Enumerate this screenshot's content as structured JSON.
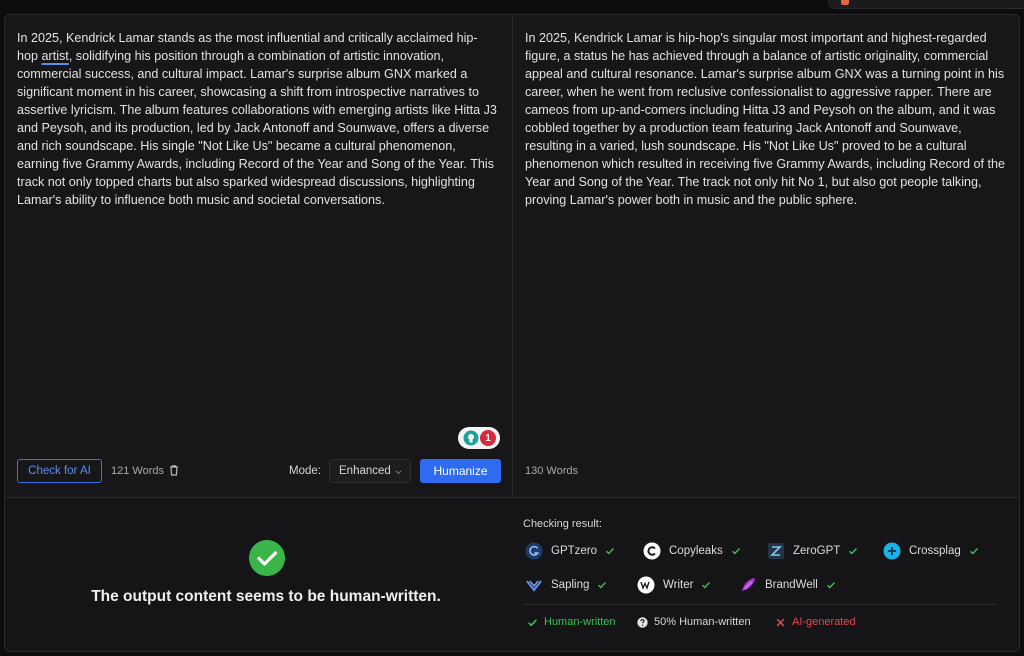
{
  "input": {
    "text_prefix": "In 2025, Kendrick Lamar stands as the most influential and critically acclaimed hip-hop ",
    "text_underlined": "artist",
    "text_suffix": ", solidifying his position through a combination of artistic innovation, commercial success, and cultural impact. Lamar's surprise album GNX marked a significant moment in his career, showcasing a shift from introspective narratives to assertive lyricism. The album features collaborations with emerging artists like Hitta J3 and Peysoh, and its production, led by Jack Antonoff and Sounwave, offers a diverse and rich soundscape. His single \"Not Like Us\" became a cultural phenomenon, earning five Grammy Awards, including Record of the Year and Song of the Year. This track not only topped charts but also sparked widespread discussions, highlighting Lamar's ability to influence both music and societal conversations.",
    "check_button": "Check for AI",
    "word_count": "121 Words",
    "mode_label": "Mode:",
    "mode_value": "Enhanced",
    "humanize_button": "Humanize",
    "suggestion_count": "1"
  },
  "output": {
    "text": "In 2025, Kendrick Lamar is hip-hop's singular most important and highest-regarded figure, a status he has  achieved through a balance of artistic originality, commercial appeal and cultural resonance. Lamar's surprise album GNX  was a turning point in his career, when he went from reclusive confessionalist to aggressive rapper. There are cameos from  up-and-comers including Hitta J3 and Peysoh on the album, and it was cobbled together by a production team featuring Jack Antonoff and Sounwave, resulting in a varied, lush soundscape. His \"Not Like Us\" proved to  be a cultural phenomenon which resulted in receiving five Grammy Awards, including Record of the Year and Song of the Year. The track not only hit No 1, but also got  people talking, proving Lamar's power both in music and the public sphere.",
    "word_count": "130 Words"
  },
  "result": {
    "message": "The output content seems to be human-written.",
    "checking_title": "Checking result:",
    "detectors": [
      {
        "name": "GPTzero",
        "icon": "gptzero-logo-icon",
        "color": "#3b82c4"
      },
      {
        "name": "Copyleaks",
        "icon": "copyleaks-logo-icon",
        "color": "#ffffff"
      },
      {
        "name": "ZeroGPT",
        "icon": "zerogpt-logo-icon",
        "color": "#4aa3d8"
      },
      {
        "name": "Crossplag",
        "icon": "crossplag-logo-icon",
        "color": "#18b4e8"
      },
      {
        "name": "Sapling",
        "icon": "sapling-logo-icon",
        "color": "#5b8df0"
      },
      {
        "name": "Writer",
        "icon": "writer-logo-icon",
        "color": "#ffffff"
      },
      {
        "name": "BrandWell",
        "icon": "brandwell-logo-icon",
        "color": "#b03ad8"
      }
    ],
    "legend": {
      "human": "Human-written",
      "half": "50% Human-written",
      "ai": "AI-generated"
    },
    "colors": {
      "human": "#3fbf4f",
      "half": "#d6d6d6",
      "ai": "#e5484d"
    }
  }
}
